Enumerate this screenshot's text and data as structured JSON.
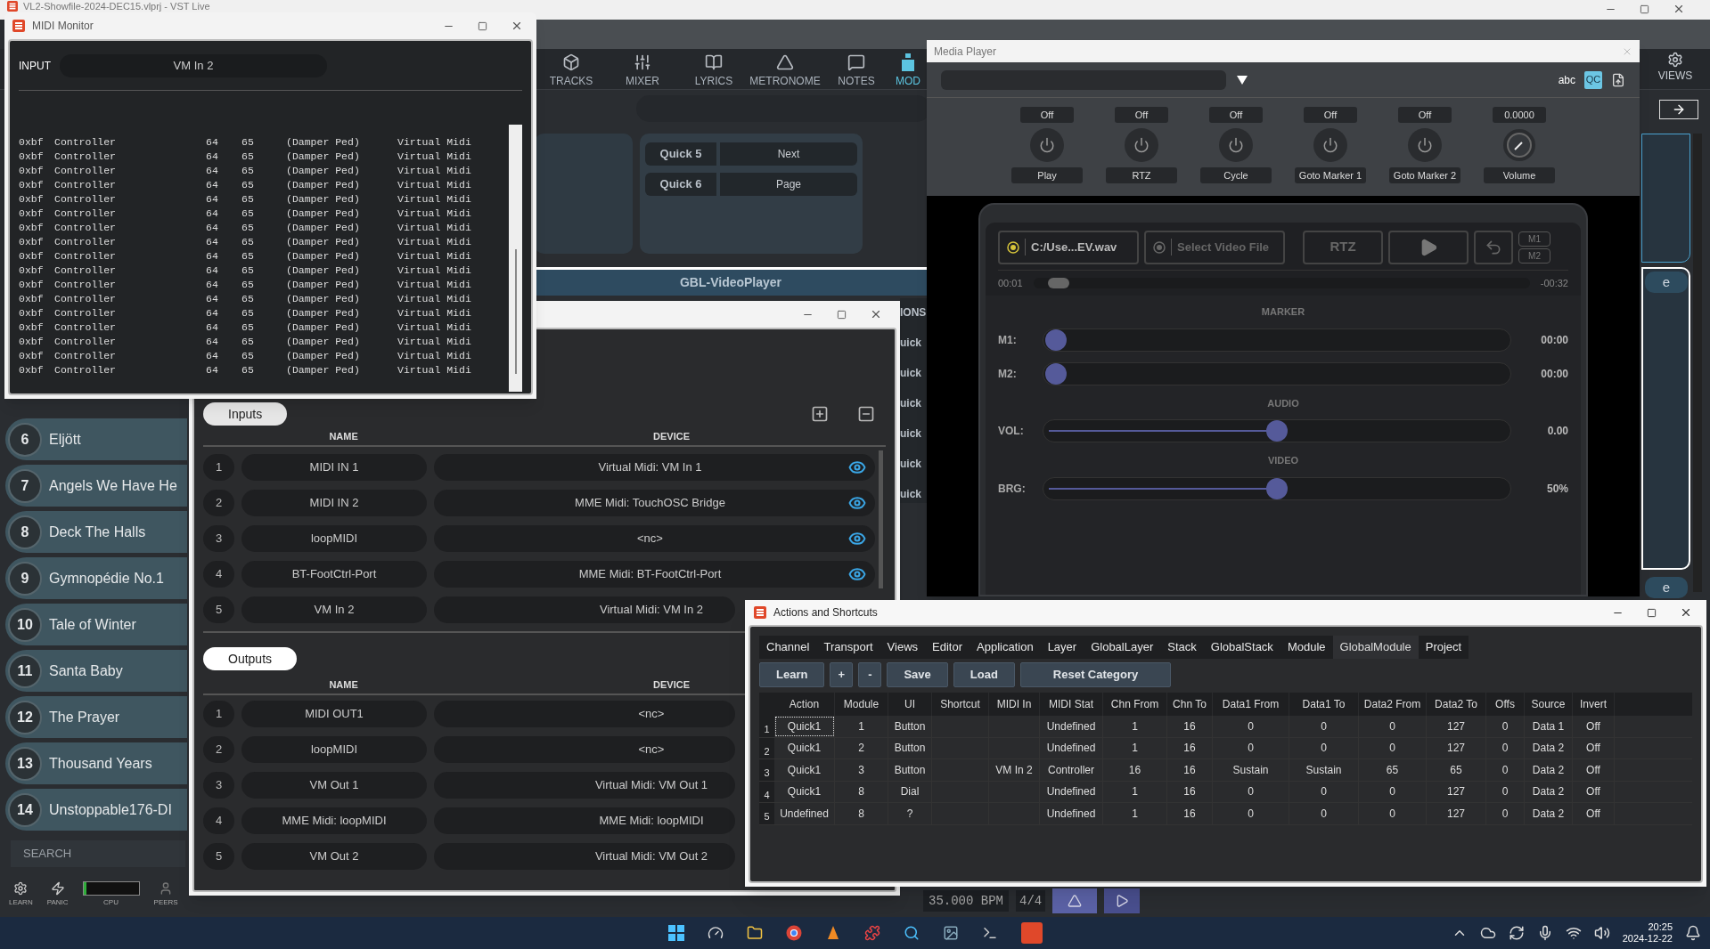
{
  "main_window": {
    "title": "VL2-Showfile-2024-DEC15.vlprj - VST Live",
    "toolbar": [
      {
        "kind": "tracks",
        "label": "TRACKS",
        "selected": false
      },
      {
        "kind": "mixer",
        "label": "MIXER",
        "selected": false
      },
      {
        "kind": "lyrics",
        "label": "LYRICS",
        "selected": false
      },
      {
        "kind": "metronome",
        "label": "METRONOME",
        "selected": false
      },
      {
        "kind": "notes",
        "label": "NOTES",
        "selected": false
      },
      {
        "kind": "modules",
        "label": "MOD",
        "selected": true
      }
    ],
    "views_label": "VIEWS",
    "quick_buttons": [
      {
        "label": "Quick 5",
        "value": "Next"
      },
      {
        "label": "Quick 6",
        "value": "Page"
      }
    ],
    "video_player_header": "GBL-VideoPlayer",
    "cut_labels": [
      "IONS",
      "uick",
      "uick",
      "uick",
      "uick",
      "uick",
      "uick"
    ],
    "side_buttons": [
      "e",
      "e"
    ],
    "songs": [
      {
        "number": "6",
        "title": "Eljött"
      },
      {
        "number": "7",
        "title": "Angels We Have He"
      },
      {
        "number": "8",
        "title": "Deck The Halls"
      },
      {
        "number": "9",
        "title": "Gymnopédie No.1"
      },
      {
        "number": "10",
        "title": "Tale of Winter"
      },
      {
        "number": "11",
        "title": "Santa Baby"
      },
      {
        "number": "12",
        "title": "The Prayer"
      },
      {
        "number": "13",
        "title": "Thousand Years"
      },
      {
        "number": "14",
        "title": "Unstoppable176-DI"
      }
    ],
    "search_placeholder": "SEARCH",
    "status_items": [
      {
        "kind": "learn",
        "label": "LEARN"
      },
      {
        "kind": "panic",
        "label": "PANIC"
      },
      {
        "kind": "cpu",
        "label": "CPU",
        "level": 0.05
      },
      {
        "kind": "peers",
        "label": "PEERS"
      }
    ],
    "transport": {
      "tempo": "35.000 BPM",
      "signature": "4/4"
    }
  },
  "midi_monitor": {
    "title": "MIDI Monitor",
    "input_label": "INPUT",
    "input_value": "VM In 2",
    "lines": [
      {
        "status": "0xbf",
        "type": "Controller",
        "data1": "64",
        "data2": "65",
        "name": "(Damper Ped)",
        "port": "Virtual Midi"
      },
      {
        "status": "0xbf",
        "type": "Controller",
        "data1": "64",
        "data2": "65",
        "name": "(Damper Ped)",
        "port": "Virtual Midi"
      },
      {
        "status": "0xbf",
        "type": "Controller",
        "data1": "64",
        "data2": "65",
        "name": "(Damper Ped)",
        "port": "Virtual Midi"
      },
      {
        "status": "0xbf",
        "type": "Controller",
        "data1": "64",
        "data2": "65",
        "name": "(Damper Ped)",
        "port": "Virtual Midi"
      },
      {
        "status": "0xbf",
        "type": "Controller",
        "data1": "64",
        "data2": "65",
        "name": "(Damper Ped)",
        "port": "Virtual Midi"
      },
      {
        "status": "0xbf",
        "type": "Controller",
        "data1": "64",
        "data2": "65",
        "name": "(Damper Ped)",
        "port": "Virtual Midi"
      },
      {
        "status": "0xbf",
        "type": "Controller",
        "data1": "64",
        "data2": "65",
        "name": "(Damper Ped)",
        "port": "Virtual Midi"
      },
      {
        "status": "0xbf",
        "type": "Controller",
        "data1": "64",
        "data2": "65",
        "name": "(Damper Ped)",
        "port": "Virtual Midi"
      },
      {
        "status": "0xbf",
        "type": "Controller",
        "data1": "64",
        "data2": "65",
        "name": "(Damper Ped)",
        "port": "Virtual Midi"
      },
      {
        "status": "0xbf",
        "type": "Controller",
        "data1": "64",
        "data2": "65",
        "name": "(Damper Ped)",
        "port": "Virtual Midi"
      },
      {
        "status": "0xbf",
        "type": "Controller",
        "data1": "64",
        "data2": "65",
        "name": "(Damper Ped)",
        "port": "Virtual Midi"
      },
      {
        "status": "0xbf",
        "type": "Controller",
        "data1": "64",
        "data2": "65",
        "name": "(Damper Ped)",
        "port": "Virtual Midi"
      },
      {
        "status": "0xbf",
        "type": "Controller",
        "data1": "64",
        "data2": "65",
        "name": "(Damper Ped)",
        "port": "Virtual Midi"
      },
      {
        "status": "0xbf",
        "type": "Controller",
        "data1": "64",
        "data2": "65",
        "name": "(Damper Ped)",
        "port": "Virtual Midi"
      },
      {
        "status": "0xbf",
        "type": "Controller",
        "data1": "64",
        "data2": "65",
        "name": "(Damper Ped)",
        "port": "Virtual Midi"
      },
      {
        "status": "0xbf",
        "type": "Controller",
        "data1": "64",
        "data2": "65",
        "name": "(Damper Ped)",
        "port": "Virtual Midi"
      },
      {
        "status": "0xbf",
        "type": "Controller",
        "data1": "64",
        "data2": "65",
        "name": "(Damper Ped)",
        "port": "Virtual Midi"
      }
    ]
  },
  "midi_devices": {
    "inputs_label": "Inputs",
    "outputs_label": "Outputs",
    "input_columns": [
      "NAME",
      "DEVICE"
    ],
    "inputs": [
      {
        "number": "1",
        "name": "MIDI IN 1",
        "device": "Virtual Midi: VM In 1"
      },
      {
        "number": "2",
        "name": "MIDI IN 2",
        "device": "MME Midi: TouchOSC Bridge"
      },
      {
        "number": "3",
        "name": "loopMIDI",
        "device": "<nc>"
      },
      {
        "number": "4",
        "name": "BT-FootCtrl-Port",
        "device": "MME Midi: BT-FootCtrl-Port"
      },
      {
        "number": "5",
        "name": "VM In 2",
        "device": "Virtual Midi: VM In 2"
      }
    ],
    "output_columns": [
      "NAME",
      "DEVICE"
    ],
    "outputs": [
      {
        "number": "1",
        "name": "MIDI OUT1",
        "device": "<nc>"
      },
      {
        "number": "2",
        "name": "loopMIDI",
        "device": "<nc>"
      },
      {
        "number": "3",
        "name": "VM Out 1",
        "device": "Virtual Midi: VM Out 1"
      },
      {
        "number": "4",
        "name": "MME Midi: loopMIDI",
        "device": "MME Midi: loopMIDI"
      },
      {
        "number": "5",
        "name": "VM Out 2",
        "device": "Virtual Midi: VM Out 2"
      }
    ]
  },
  "media_player": {
    "title": "Media Player",
    "toolbar_text": "abc",
    "qc_label": "QC",
    "controls": [
      {
        "value": "Off",
        "label": "Play",
        "kind": "switch"
      },
      {
        "value": "Off",
        "label": "RTZ",
        "kind": "switch"
      },
      {
        "value": "Off",
        "label": "Cycle",
        "kind": "switch"
      },
      {
        "value": "Off",
        "label": "Goto Marker 1",
        "kind": "switch"
      },
      {
        "value": "Off",
        "label": "Goto Marker 2",
        "kind": "switch"
      },
      {
        "value": "0.0000",
        "label": "Volume",
        "kind": "dial"
      }
    ],
    "file_button": "C:/Use...EV.wav",
    "video_button": "Select Video File",
    "rtz_button": "RTZ",
    "marker_buttons": [
      "M1",
      "M2"
    ],
    "elapsed": "00:01",
    "remaining": "-00:32",
    "progress": {
      "level": 0.03
    },
    "sections": [
      {
        "title": "MARKER",
        "sliders": [
          {
            "label": "M1:",
            "level": 0,
            "reading": "00:00"
          },
          {
            "label": "M2:",
            "level": 0,
            "reading": "00:00"
          }
        ]
      },
      {
        "title": "AUDIO",
        "sliders": [
          {
            "label": "VOL:",
            "level": 0.5,
            "reading": "0.00"
          }
        ]
      },
      {
        "title": "VIDEO",
        "sliders": [
          {
            "label": "BRG:",
            "level": 0.5,
            "reading": "50%"
          }
        ]
      }
    ]
  },
  "actions": {
    "title": "Actions and Shortcuts",
    "tabs": [
      {
        "label": "Channel",
        "selected": false
      },
      {
        "label": "Transport",
        "selected": false
      },
      {
        "label": "Views",
        "selected": false
      },
      {
        "label": "Editor",
        "selected": false
      },
      {
        "label": "Application",
        "selected": false
      },
      {
        "label": "Layer",
        "selected": false
      },
      {
        "label": "GlobalLayer",
        "selected": false
      },
      {
        "label": "Stack",
        "selected": false
      },
      {
        "label": "GlobalStack",
        "selected": false
      },
      {
        "label": "Module",
        "selected": false
      },
      {
        "label": "GlobalModule",
        "selected": true
      },
      {
        "label": "Project",
        "selected": false
      }
    ],
    "buttons": [
      "Learn",
      "+",
      "-",
      "Save",
      "Load",
      "Reset Category"
    ],
    "columns": [
      "Action",
      "Module",
      "UI",
      "Shortcut",
      "MIDI In",
      "MIDI Stat",
      "Chn From",
      "Chn To",
      "Data1 From",
      "Data1 To",
      "Data2 From",
      "Data2 To",
      "Offs",
      "Source",
      "Invert"
    ],
    "rows": [
      {
        "number": "1",
        "focused": true,
        "cells": [
          "Quick1",
          "1",
          "Button",
          "",
          "",
          "Undefined",
          "1",
          "16",
          "0",
          "0",
          "0",
          "127",
          "0",
          "Data 1",
          "Off"
        ]
      },
      {
        "number": "2",
        "focused": false,
        "cells": [
          "Quick1",
          "2",
          "Button",
          "",
          "",
          "Undefined",
          "1",
          "16",
          "0",
          "0",
          "0",
          "127",
          "0",
          "Data 2",
          "Off"
        ]
      },
      {
        "number": "3",
        "focused": false,
        "cells": [
          "Quick1",
          "3",
          "Button",
          "",
          "VM In 2",
          "Controller",
          "16",
          "16",
          "Sustain",
          "Sustain",
          "65",
          "65",
          "0",
          "Data 2",
          "Off"
        ]
      },
      {
        "number": "4",
        "focused": false,
        "cells": [
          "Quick1",
          "8",
          "Dial",
          "",
          "",
          "Undefined",
          "1",
          "16",
          "0",
          "0",
          "0",
          "127",
          "0",
          "Data 2",
          "Off"
        ]
      },
      {
        "number": "5",
        "focused": false,
        "cells": [
          "Undefined",
          "8",
          "?",
          "",
          "",
          "Undefined",
          "1",
          "16",
          "0",
          "0",
          "0",
          "127",
          "0",
          "Data 2",
          "Off"
        ]
      }
    ]
  },
  "taskbar": {
    "time": "20:25",
    "date": "2024-12-22"
  }
}
